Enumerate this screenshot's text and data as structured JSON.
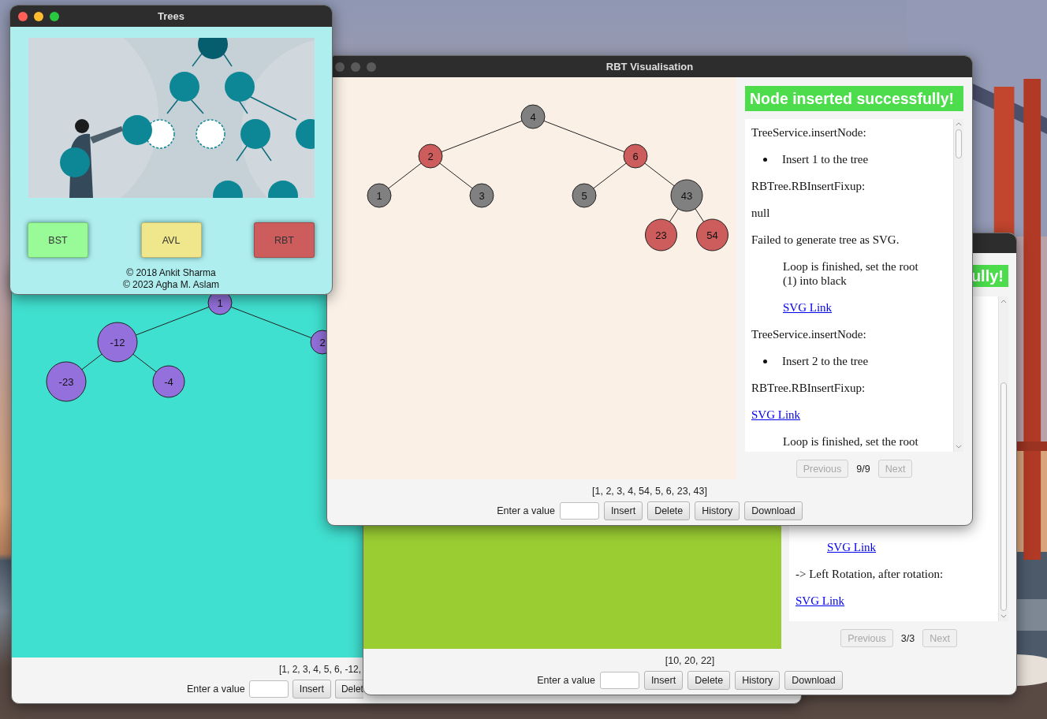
{
  "bst_window": {
    "tree": {
      "label": "1",
      "children": [
        {
          "label": "-12",
          "children": [
            {
              "label": "-23"
            },
            {
              "label": "-4"
            }
          ]
        },
        {
          "label": "2"
        }
      ]
    },
    "values": "[1, 2, 3, 4, 5, 6, -12,",
    "input_label": "Enter a value",
    "buttons": [
      "Insert",
      "Delet"
    ]
  },
  "avl_window": {
    "banner": "ully!",
    "log": [
      {
        "kind": "indent-link",
        "text": "SVG Link"
      },
      {
        "kind": "text",
        "text": "-> Left Rotation, after rotation:"
      },
      {
        "kind": "link",
        "text": "SVG Link"
      }
    ],
    "pager": {
      "previous": {
        "label": "Previous",
        "disabled": true
      },
      "page": "3/3",
      "next": {
        "label": "Next",
        "disabled": true
      }
    },
    "values": "[10, 20, 22]",
    "input_label": "Enter a value",
    "buttons": [
      "Insert",
      "Delete",
      "History",
      "Download"
    ]
  },
  "rbt_window": {
    "title": "RBT Visualisation",
    "tree": {
      "label": "4",
      "color": "#808080",
      "children": [
        {
          "label": "2",
          "color": "#cd5c5c",
          "children": [
            {
              "label": "1",
              "color": "#808080"
            },
            {
              "label": "3",
              "color": "#808080"
            }
          ]
        },
        {
          "label": "6",
          "color": "#cd5c5c",
          "children": [
            {
              "label": "5",
              "color": "#808080"
            },
            {
              "label": "43",
              "color": "#808080",
              "children": [
                {
                  "label": "23",
                  "color": "#cd5c5c"
                },
                {
                  "label": "54",
                  "color": "#cd5c5c"
                }
              ]
            }
          ]
        }
      ]
    },
    "banner": "Node inserted successfully!",
    "log": [
      {
        "kind": "text",
        "text": "TreeService.insertNode:"
      },
      {
        "kind": "bullet",
        "text": "Insert 1 to the tree"
      },
      {
        "kind": "text",
        "text": "RBTree.RBInsertFixup:"
      },
      {
        "kind": "text",
        "text": "null"
      },
      {
        "kind": "text",
        "text": "Failed to generate tree as SVG."
      },
      {
        "kind": "indent",
        "text": "Loop is finished, set the root (1) into black"
      },
      {
        "kind": "indent-link",
        "text": "SVG Link"
      },
      {
        "kind": "text",
        "text": "TreeService.insertNode:"
      },
      {
        "kind": "bullet",
        "text": "Insert 2 to the tree"
      },
      {
        "kind": "text",
        "text": "RBTree.RBInsertFixup:"
      },
      {
        "kind": "link",
        "text": "SVG Link"
      },
      {
        "kind": "indent",
        "text": "Loop is finished, set the root"
      }
    ],
    "pager": {
      "previous": {
        "label": "Previous",
        "disabled": true
      },
      "page": "9/9",
      "next": {
        "label": "Next",
        "disabled": true
      }
    },
    "values": "[1, 2, 3, 4, 54, 5, 6, 23, 43]",
    "input_label": "Enter a value",
    "buttons": [
      "Insert",
      "Delete",
      "History",
      "Download"
    ]
  },
  "trees_window": {
    "title": "Trees",
    "buttons": [
      {
        "label": "BST",
        "color": "#98fb98"
      },
      {
        "label": "AVL",
        "color": "#f0e68c"
      },
      {
        "label": "RBT",
        "color": "#cd5c5c"
      }
    ],
    "credits": [
      "© 2018 Ankit Sharma",
      "© 2023 Agha M. Aslam"
    ]
  }
}
